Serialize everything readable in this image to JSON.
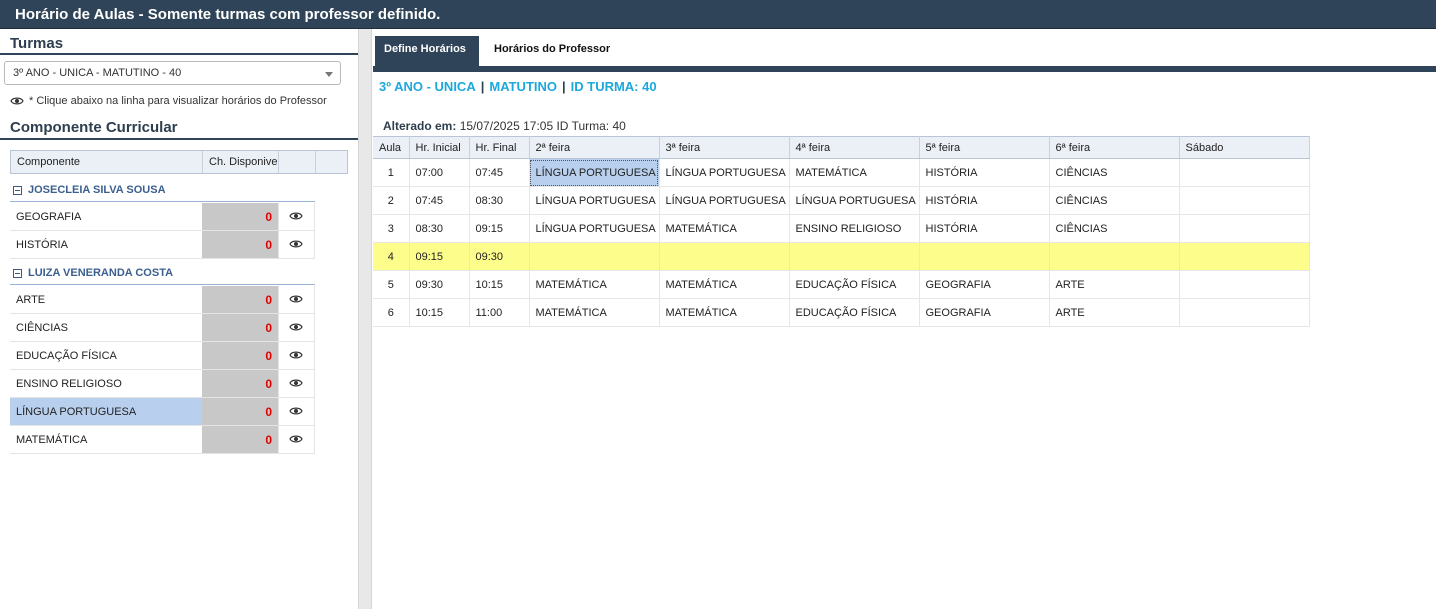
{
  "window": {
    "title": "Horário de Aulas - Somente turmas com professor definido."
  },
  "left": {
    "turmas_title": "Turmas",
    "turma_select": {
      "value": "3º ANO - UNICA - MATUTINO - 40"
    },
    "hint": "* Clique abaixo na linha para visualizar horários do Professor",
    "componente_title": "Componente Curricular",
    "columns": [
      "Componente",
      "Ch. Disponivel"
    ],
    "groups": [
      {
        "teacher": "JOSECLEIA SILVA SOUSA",
        "items": [
          {
            "name": "GEOGRAFIA",
            "ch": "0"
          },
          {
            "name": "HISTÓRIA",
            "ch": "0"
          }
        ]
      },
      {
        "teacher": "LUIZA VENERANDA COSTA",
        "items": [
          {
            "name": "ARTE",
            "ch": "0"
          },
          {
            "name": "CIÊNCIAS",
            "ch": "0"
          },
          {
            "name": "EDUCAÇÃO FÍSICA",
            "ch": "0"
          },
          {
            "name": "ENSINO RELIGIOSO",
            "ch": "0"
          },
          {
            "name": "LÍNGUA PORTUGUESA",
            "ch": "0"
          },
          {
            "name": "MATEMÁTICA",
            "ch": "0"
          }
        ]
      }
    ]
  },
  "tabs": [
    "Define Horários",
    "Horários do Professor"
  ],
  "turma_info": {
    "serie": "3º ANO - UNICA",
    "turno": "MATUTINO",
    "id": "ID TURMA: 40"
  },
  "altered": {
    "label": "Alterado em:",
    "value": "15/07/2025 17:05 ID Turma: 40"
  },
  "schedule": {
    "columns": [
      "Aula",
      "Hr. Inicial",
      "Hr. Final",
      "2ª feira",
      "3ª feira",
      "4ª feira",
      "5ª feira",
      "6ª feira",
      "Sábado"
    ],
    "rows": [
      [
        "1",
        "07:00",
        "07:45",
        "LÍNGUA PORTUGUESA",
        "LÍNGUA PORTUGUESA",
        "MATEMÁTICA",
        "HISTÓRIA",
        "CIÊNCIAS",
        ""
      ],
      [
        "2",
        "07:45",
        "08:30",
        "LÍNGUA PORTUGUESA",
        "LÍNGUA PORTUGUESA",
        "LÍNGUA PORTUGUESA",
        "HISTÓRIA",
        "CIÊNCIAS",
        ""
      ],
      [
        "3",
        "08:30",
        "09:15",
        "LÍNGUA PORTUGUESA",
        "MATEMÁTICA",
        "ENSINO RELIGIOSO",
        "HISTÓRIA",
        "CIÊNCIAS",
        ""
      ],
      [
        "4",
        "09:15",
        "09:30",
        "",
        "",
        "",
        "",
        "",
        ""
      ],
      [
        "5",
        "09:30",
        "10:15",
        "MATEMÁTICA",
        "MATEMÁTICA",
        "EDUCAÇÃO FÍSICA",
        "GEOGRAFIA",
        "ARTE",
        ""
      ],
      [
        "6",
        "10:15",
        "11:00",
        "MATEMÁTICA",
        "MATEMÁTICA",
        "EDUCAÇÃO FÍSICA",
        "GEOGRAFIA",
        "ARTE",
        ""
      ]
    ]
  }
}
